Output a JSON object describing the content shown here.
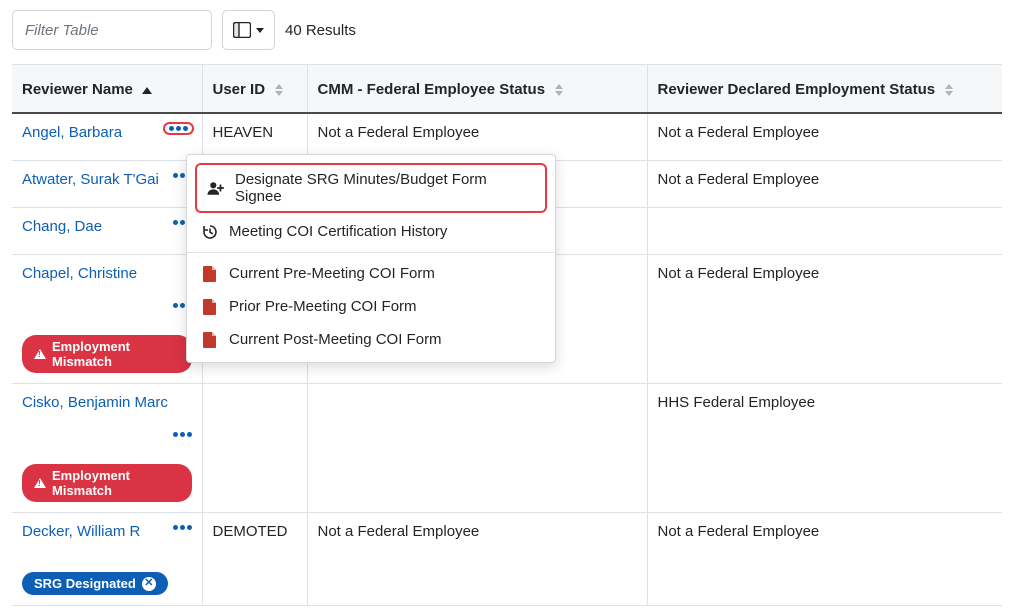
{
  "toolbar": {
    "filter_placeholder": "Filter Table",
    "results_label": "40 Results"
  },
  "columns": {
    "reviewer": "Reviewer Name",
    "userid": "User ID",
    "cmm": "CMM - Federal Employee Status",
    "declared": "Reviewer Declared Employment Status"
  },
  "rows": [
    {
      "name": "Angel, Barbara",
      "userid": "HEAVEN",
      "cmm": "Not a Federal Employee",
      "declared": "Not a Federal Employee",
      "badge": null,
      "menu_highlight": true
    },
    {
      "name": "Atwater, Surak T'Gai",
      "userid": "",
      "cmm": "",
      "declared": "Not a Federal Employee",
      "badge": null
    },
    {
      "name": "Chang, Dae",
      "userid": "",
      "cmm": "",
      "declared": "",
      "badge": null
    },
    {
      "name": "Chapel, Christine",
      "userid": "",
      "cmm": "",
      "declared": "Not a Federal Employee",
      "badge": {
        "type": "red",
        "text": "Employment Mismatch"
      },
      "menu_below": true
    },
    {
      "name": "Cisko, Benjamin Marc",
      "userid": "",
      "cmm": "",
      "declared": "HHS Federal Employee",
      "badge": {
        "type": "red",
        "text": "Employment Mismatch"
      },
      "menu_below": true
    },
    {
      "name": "Decker, William R",
      "userid": "DEMOTED",
      "cmm": "Not a Federal Employee",
      "declared": "Not a Federal Employee",
      "badge": {
        "type": "blue",
        "text": "SRG Designated"
      }
    }
  ],
  "menu": {
    "designate": "Designate SRG Minutes/Budget Form Signee",
    "history": "Meeting COI Certification History",
    "current_pre": "Current Pre-Meeting COI Form",
    "prior_pre": "Prior Pre-Meeting COI Form",
    "current_post": "Current Post-Meeting COI Form"
  }
}
